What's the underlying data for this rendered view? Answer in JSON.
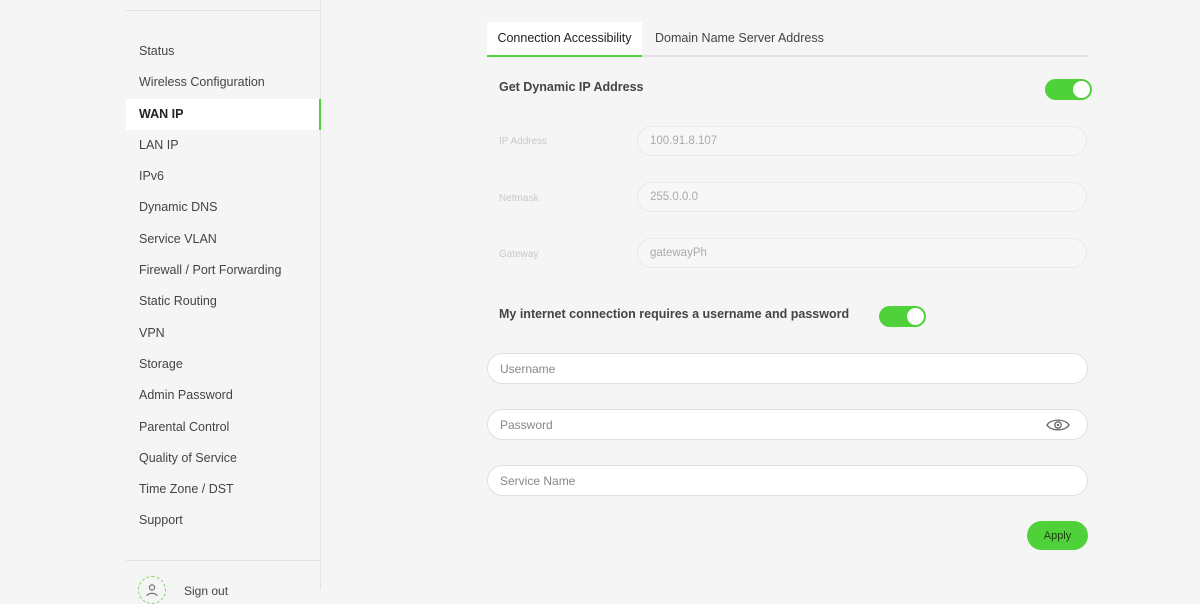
{
  "sidebar": {
    "items": [
      {
        "label": "Status",
        "active": false
      },
      {
        "label": "Wireless Configuration",
        "active": false
      },
      {
        "label": "WAN IP",
        "active": true
      },
      {
        "label": "LAN IP",
        "active": false
      },
      {
        "label": "IPv6",
        "active": false
      },
      {
        "label": "Dynamic DNS",
        "active": false
      },
      {
        "label": "Service VLAN",
        "active": false
      },
      {
        "label": "Firewall / Port Forwarding",
        "active": false
      },
      {
        "label": "Static Routing",
        "active": false
      },
      {
        "label": "VPN",
        "active": false
      },
      {
        "label": "Storage",
        "active": false
      },
      {
        "label": "Admin Password",
        "active": false
      },
      {
        "label": "Parental Control",
        "active": false
      },
      {
        "label": "Quality of Service",
        "active": false
      },
      {
        "label": "Time Zone / DST",
        "active": false
      },
      {
        "label": "Support",
        "active": false
      }
    ],
    "user": {
      "name": "Sign out"
    }
  },
  "tabs": [
    {
      "label": "Connection Accessibility",
      "active": true
    },
    {
      "label": "Domain Name Server Address",
      "active": false
    }
  ],
  "dynamic_ip": {
    "label": "Get Dynamic IP Address",
    "enabled": true
  },
  "static_fields": {
    "ip_address": {
      "label": "IP Address",
      "value": "100.91.8.107"
    },
    "netmask": {
      "label": "Netmask",
      "value": "255.0.0.0"
    },
    "gateway": {
      "label": "Gateway",
      "placeholder": "gatewayPh"
    }
  },
  "auth": {
    "label": "My internet connection requires a username and password",
    "enabled": true,
    "username_placeholder": "Username",
    "password_placeholder": "Password",
    "service_name_placeholder": "Service Name"
  },
  "actions": {
    "apply_label": "Apply"
  },
  "colors": {
    "accent": "#4fd13a",
    "background": "#f5f5f5"
  }
}
